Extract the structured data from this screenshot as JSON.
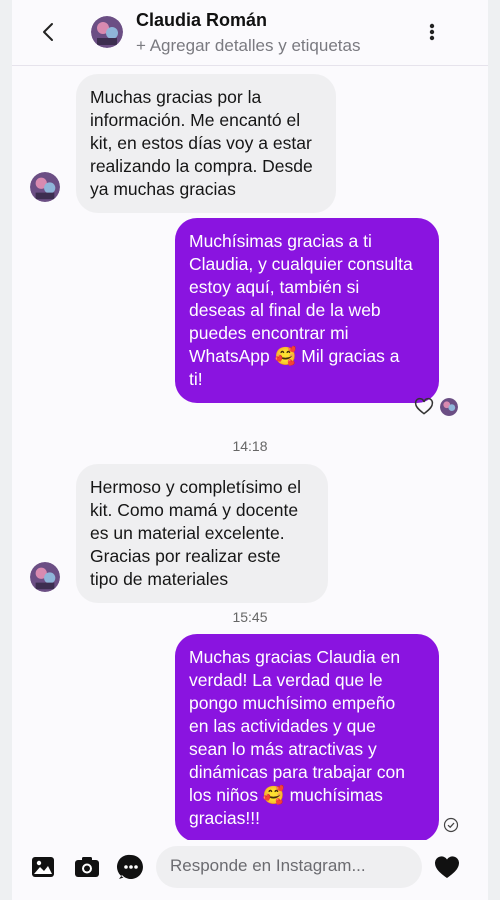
{
  "header": {
    "name": "Claudia Román",
    "subtitle": "+ Agregar detalles y etiquetas",
    "back_icon": "chevron-left-icon",
    "more_icon": "more-vertical-icon"
  },
  "messages": [
    {
      "side": "in",
      "text": "Muchas gracias por la\ninformación. Me encantó el\nkit, en estos días voy a estar\nrealizando la compra. Desde\nya muchas gracias"
    },
    {
      "side": "out",
      "text": "Muchísimas gracias a ti\nClaudia, y cualquier consulta\nestoy aquí, también si\ndeseas al final de la web\npuedes encontrar mi\nWhatsApp 🥰 Mil gracias a\nti!"
    },
    {
      "side": "in",
      "text": "Hermoso y completísimo el\nkit. Como mamá y docente\nes un material excelente.\nGracias por realizar este\ntipo de materiales"
    },
    {
      "side": "out",
      "text": "Muchas gracias Claudia en\nverdad! La verdad que le\npongo muchísimo empeño\nen las actividades y que\nsean lo más atractivas y\ndinámicas para trabajar con\nlos niños 🥰 muchísimas\ngracias!!!"
    }
  ],
  "timestamps": [
    "14:18",
    "15:45"
  ],
  "composer": {
    "placeholder": "Responde en Instagram..."
  },
  "colors": {
    "outgoing_bubble": "#8a14e0",
    "incoming_bubble": "#efeff1"
  }
}
